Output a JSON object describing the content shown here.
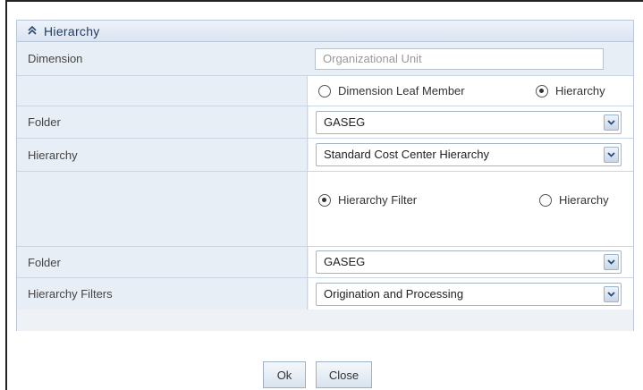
{
  "panel": {
    "title": "Hierarchy"
  },
  "rows": {
    "dimension": {
      "label": "Dimension",
      "value": "Organizational Unit"
    },
    "radio1": {
      "option1": "Dimension Leaf Member",
      "option2": "Hierarchy",
      "selected": "Hierarchy"
    },
    "folder1": {
      "label": "Folder",
      "value": "GASEG"
    },
    "hierarchy": {
      "label": "Hierarchy",
      "value": "Standard Cost Center Hierarchy"
    },
    "radio2": {
      "option1": "Hierarchy Filter",
      "option2": "Hierarchy",
      "selected": "Hierarchy Filter"
    },
    "folder2": {
      "label": "Folder",
      "value": "GASEG"
    },
    "filters": {
      "label": "Hierarchy Filters",
      "value": "Origination and Processing"
    }
  },
  "buttons": {
    "ok": "Ok",
    "close": "Close"
  },
  "icons": {
    "collapse": "double-chevron-up-icon",
    "dropdown": "chevron-down-icon"
  }
}
